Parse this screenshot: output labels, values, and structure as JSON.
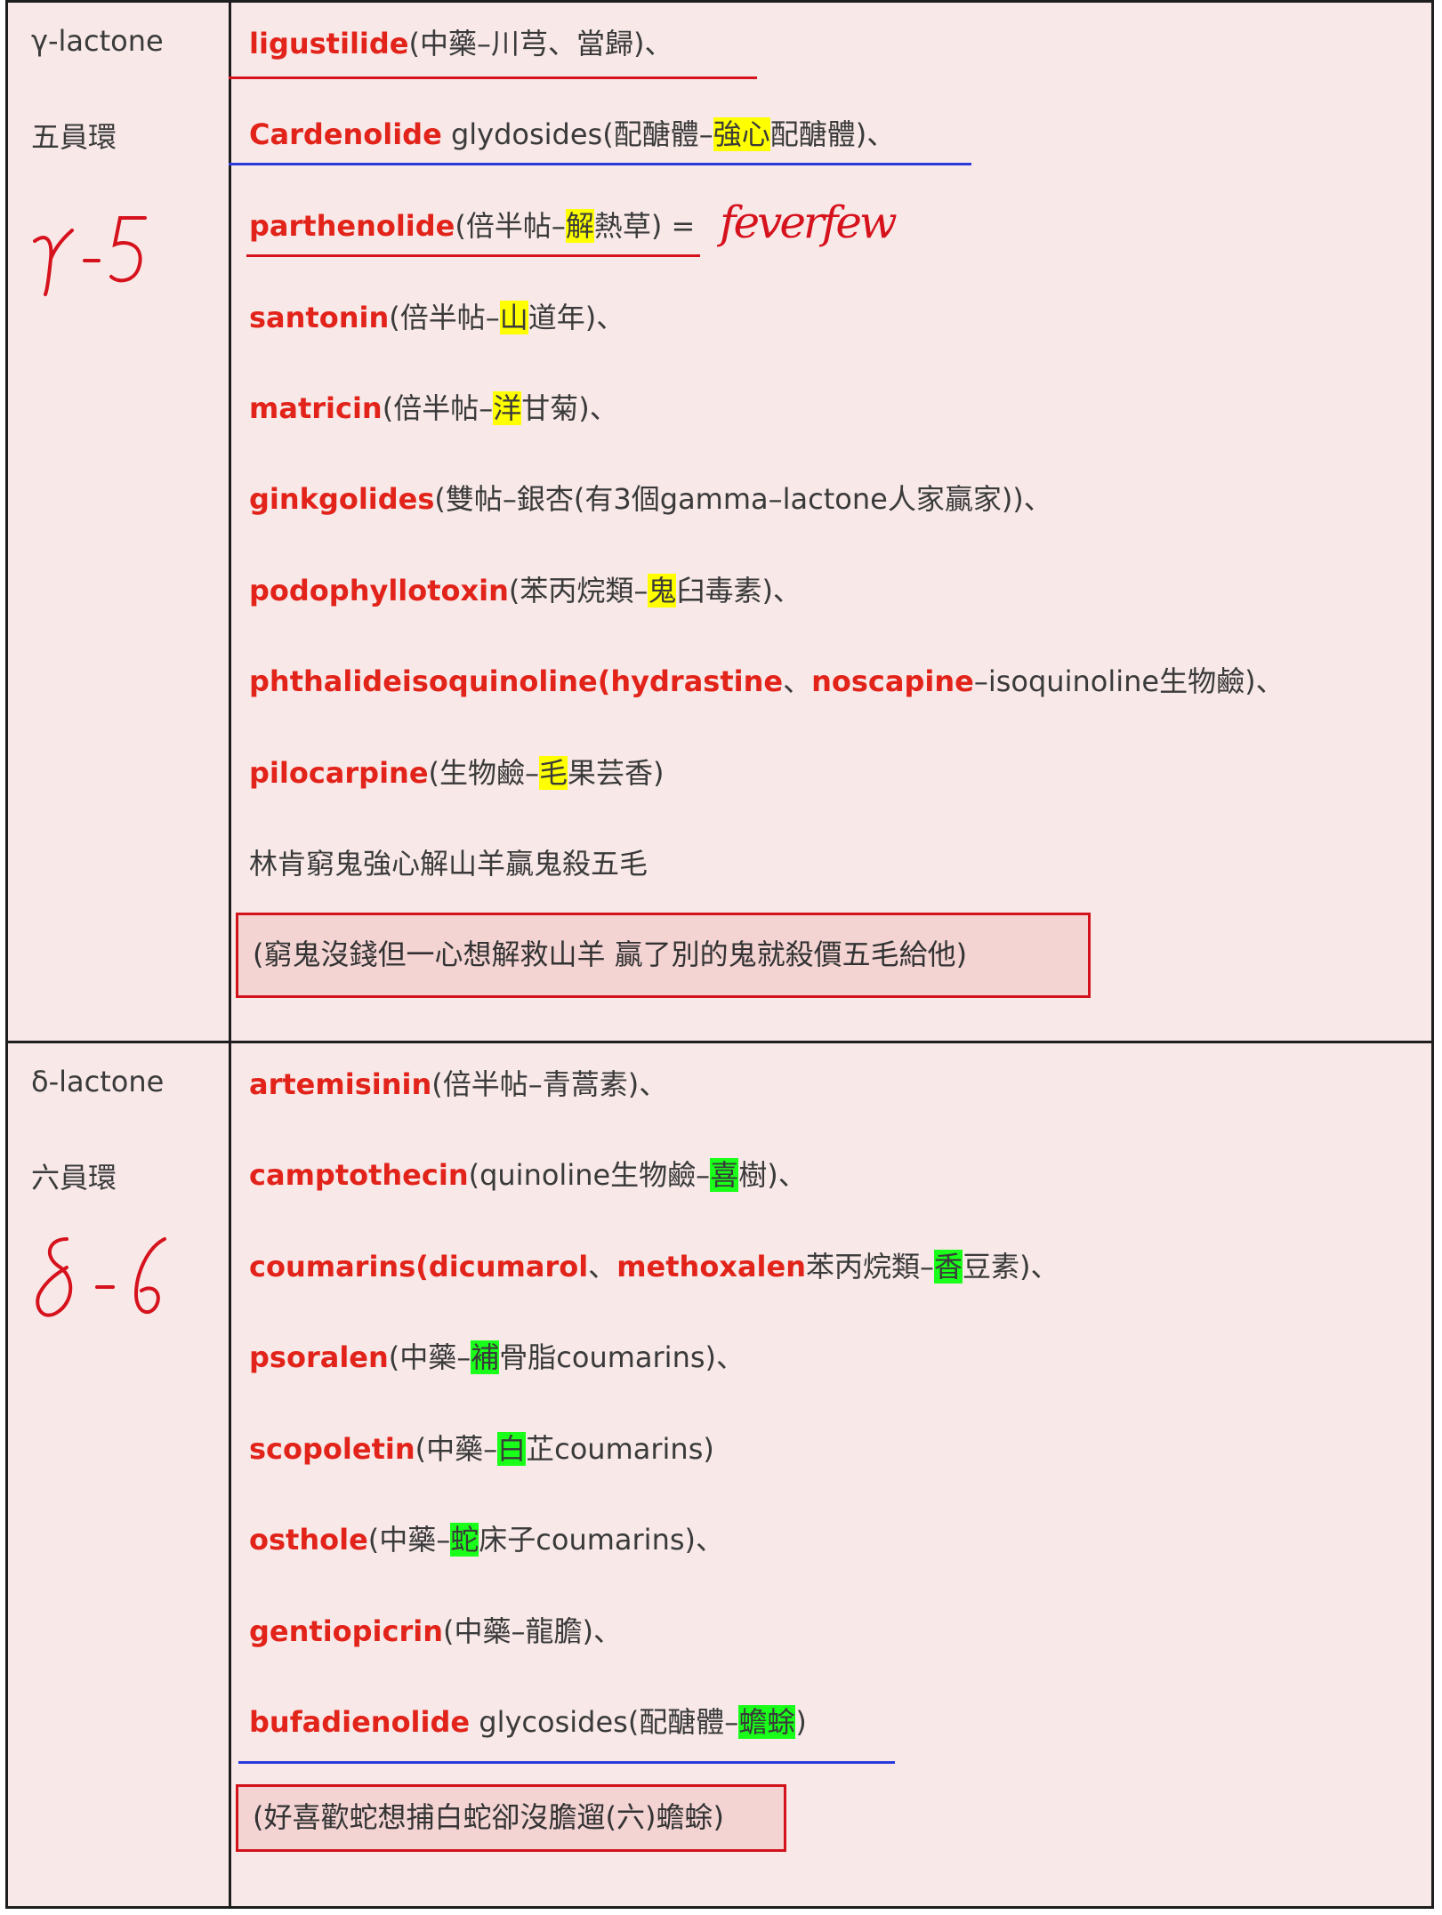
{
  "sections": [
    {
      "type_label": "γ-lactone",
      "ring_label": "五員環",
      "handwritten": "γ-5",
      "rows": [
        {
          "name": "ligustilide",
          "pre": "",
          "mark": "",
          "post": "(中藥–川芎、當歸)、"
        },
        {
          "name": "Cardenolide",
          "pre": " glydosides(配醣體–",
          "mark": "強心",
          "post": "配醣體)、"
        },
        {
          "name": "parthenolide",
          "pre": "(倍半帖–",
          "mark": "解",
          "post": "熱草) ="
        },
        {
          "name": "santonin",
          "pre": "(倍半帖–",
          "mark": "山",
          "post": "道年)、"
        },
        {
          "name": "matricin",
          "pre": "(倍半帖–",
          "mark": "洋",
          "post": "甘菊)、"
        },
        {
          "name": "ginkgolides",
          "pre": "",
          "mark": "",
          "post": "(雙帖–銀杏(有3個gamma–lactone人家贏家))、"
        },
        {
          "name": "podophyllotoxin",
          "pre": "(苯丙烷類–",
          "mark": "鬼",
          "post": "臼毒素)、"
        },
        {
          "name": "pilocarpine",
          "pre": "(生物鹼–",
          "mark": "毛",
          "post": "果芸香)"
        }
      ],
      "phthalide": {
        "a": "phthalideisoquinoline(hydrastine",
        "sep": "、",
        "b": "noscapine",
        "rest": "–isoquinoline生物鹼)、"
      },
      "handwritten_note": "feverfew",
      "mnemonic": "林肯窮鬼強心解山羊贏鬼殺五毛",
      "box_text": "(窮鬼沒錢但一心想解救山羊 贏了別的鬼就殺價五毛給他)"
    },
    {
      "type_label": "δ-lactone",
      "ring_label": "六員環",
      "handwritten": "δ-6",
      "rows": [
        {
          "name": "artemisinin",
          "pre": "",
          "mark": "",
          "post": "(倍半帖–青蒿素)、"
        },
        {
          "name": "camptothecin",
          "pre": "(quinoline生物鹼–",
          "mark": "喜",
          "post": "樹)、"
        },
        {
          "name": "psoralen",
          "pre": "(中藥–",
          "mark": "補",
          "post": "骨脂coumarins)、"
        },
        {
          "name": "scopoletin",
          "pre": "(中藥–",
          "mark": "白",
          "post": "芷coumarins)"
        },
        {
          "name": "osthole",
          "pre": "(中藥–",
          "mark": "蛇",
          "post": "床子coumarins)、"
        },
        {
          "name": "gentiopicrin",
          "pre": "",
          "mark": "",
          "post": "(中藥–龍膽)、"
        },
        {
          "name": "bufadienolide",
          "pre": " glycosides(配醣體–",
          "mark": "蟾蜍",
          "post": ")"
        }
      ],
      "coumarins": {
        "a": "coumarins(dicumarol",
        "sep": "、",
        "b": "methoxalen",
        "pre": "苯丙烷類–",
        "mark": "香",
        "post": "豆素)、"
      },
      "box_text": "(好喜歡蛇想捕白蛇卻沒膽遛(六)蟾蜍)"
    }
  ],
  "colors": {
    "accent": "#e2231a",
    "yellow_highlight": "#ffff00",
    "green_highlight": "#1aff1a",
    "underline_blue": "#2a3adb"
  }
}
